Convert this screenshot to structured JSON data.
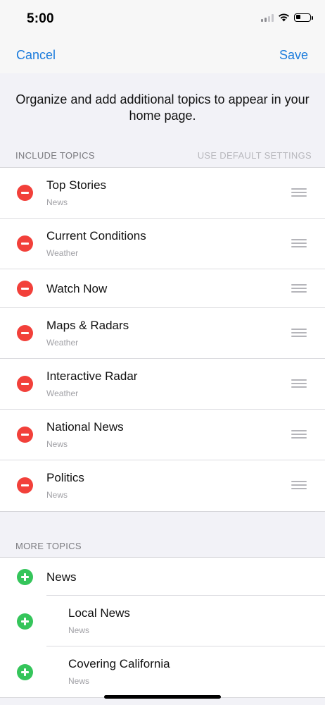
{
  "status_bar": {
    "time": "5:00",
    "battery_level": 0.35
  },
  "nav": {
    "cancel_label": "Cancel",
    "save_label": "Save"
  },
  "intro_text": "Organize and add additional topics to appear in your home page.",
  "include_section": {
    "header": "INCLUDE TOPICS",
    "action": "USE DEFAULT SETTINGS",
    "items": [
      {
        "title": "Top Stories",
        "subtitle": "News"
      },
      {
        "title": "Current Conditions",
        "subtitle": "Weather"
      },
      {
        "title": "Watch Now",
        "subtitle": ""
      },
      {
        "title": "Maps & Radars",
        "subtitle": "Weather"
      },
      {
        "title": "Interactive Radar",
        "subtitle": "Weather"
      },
      {
        "title": "National News",
        "subtitle": "News"
      },
      {
        "title": "Politics",
        "subtitle": "News"
      }
    ]
  },
  "more_section": {
    "header": "MORE TOPICS",
    "items": [
      {
        "title": "News",
        "subtitle": ""
      },
      {
        "title": "Local News",
        "subtitle": "News"
      },
      {
        "title": "Covering California",
        "subtitle": "News"
      }
    ]
  },
  "colors": {
    "accent": "#1a7bdc",
    "remove": "#f2403a",
    "add": "#35c55b"
  }
}
